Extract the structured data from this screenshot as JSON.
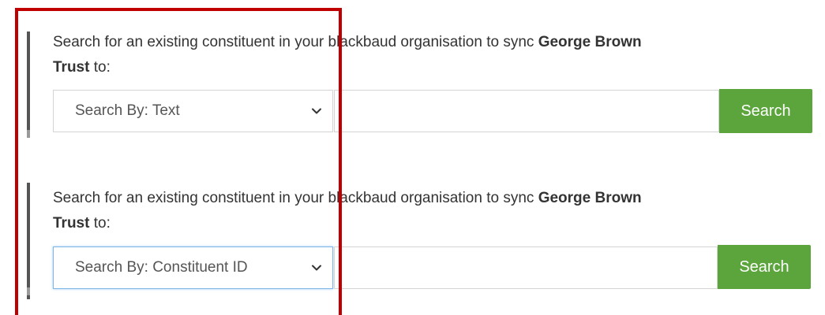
{
  "sections": [
    {
      "prompt_prefix": "Search for an existing constituent in your blackbaud organisation to sync ",
      "org_name": "George Brown",
      "org_name_cont": "Trust",
      "prompt_suffix": " to:",
      "select_value": "Search By: Text",
      "input_value": "",
      "button_label": "Search"
    },
    {
      "prompt_prefix": "Search for an existing constituent in your blackbaud organisation to sync ",
      "org_name": "George Brown",
      "org_name_cont": "Trust",
      "prompt_suffix": " to:",
      "select_value": "Search By: Constituent ID",
      "input_value": "",
      "button_label": "Search"
    }
  ],
  "colors": {
    "button_bg": "#5ba53c",
    "highlight_border": "#c00000",
    "focus_border": "#7fb5e8"
  },
  "icons": {
    "select_chevron": "chevron-down-icon"
  }
}
